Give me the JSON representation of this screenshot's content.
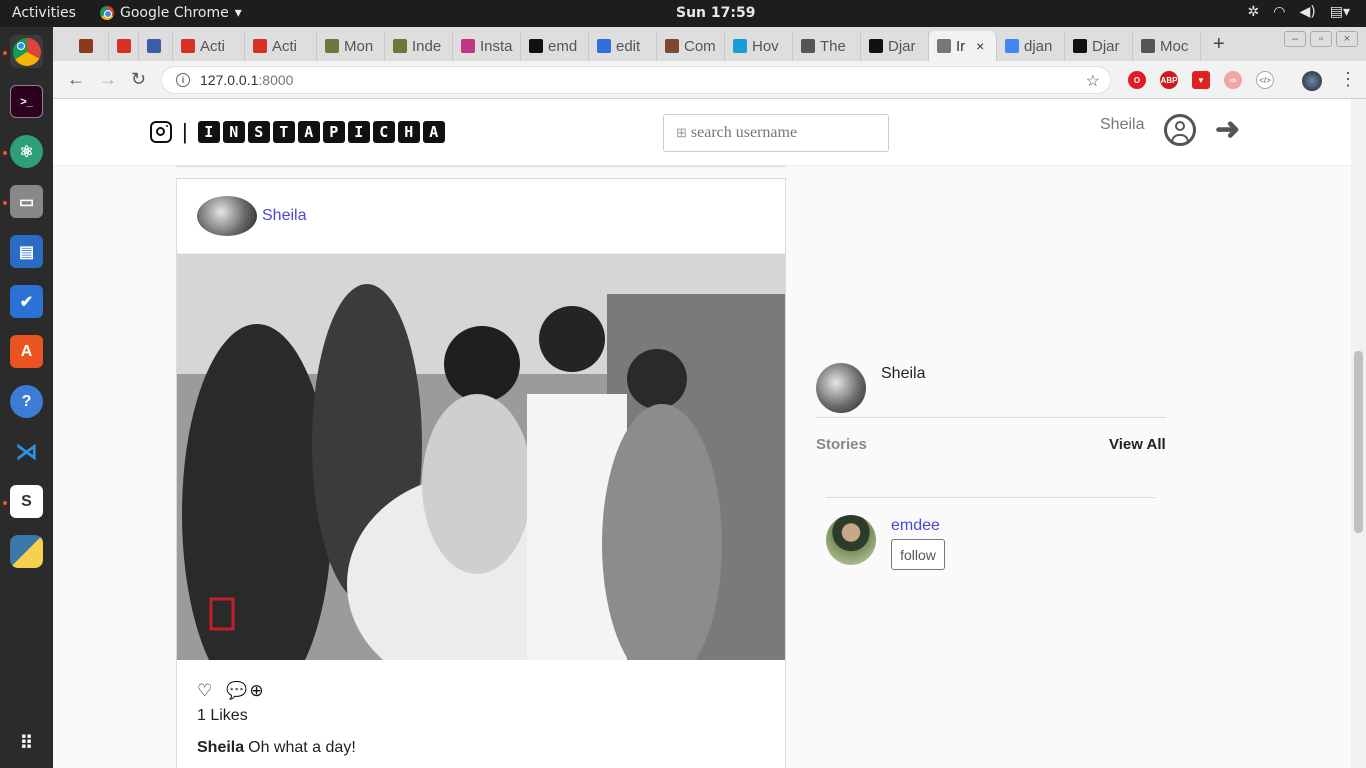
{
  "os": {
    "activities": "Activities",
    "app_name": "Google Chrome",
    "clock": "Sun 17:59"
  },
  "browser": {
    "tabs": [
      {
        "label": "",
        "icon": "book-icon",
        "color": "#8b3a1a"
      },
      {
        "label": "",
        "icon": "gmail-icon",
        "color": "#d93025"
      },
      {
        "label": "",
        "icon": "lifebuoy-icon",
        "color": "#3a5ea8"
      },
      {
        "label": "Acti",
        "icon": "gmail-icon",
        "color": "#d93025"
      },
      {
        "label": "Acti",
        "icon": "gmail-icon",
        "color": "#d93025"
      },
      {
        "label": "Mon",
        "icon": "tree-icon",
        "color": "#6b7a3a"
      },
      {
        "label": "Inde",
        "icon": "tree-icon",
        "color": "#6b7a3a"
      },
      {
        "label": "Insta",
        "icon": "instagram-icon",
        "color": "#c13584"
      },
      {
        "label": "emd",
        "icon": "github-icon",
        "color": "#111111"
      },
      {
        "label": "edit",
        "icon": "flag-icon",
        "color": "#2f6fe0"
      },
      {
        "label": "Com",
        "icon": "photo-icon",
        "color": "#7a4a2a"
      },
      {
        "label": "Hov",
        "icon": "s-icon",
        "color": "#1b9bd8"
      },
      {
        "label": "The",
        "icon": "doc-icon",
        "color": "#555555"
      },
      {
        "label": "Djar",
        "icon": "medium-icon",
        "color": "#111111"
      },
      {
        "label": "Ir",
        "icon": "page-icon",
        "color": "#777777"
      },
      {
        "label": "djan",
        "icon": "google-icon",
        "color": "#4285f4"
      },
      {
        "label": "Djar",
        "icon": "medium-icon",
        "color": "#111111"
      },
      {
        "label": "Moc",
        "icon": "puzzle-icon",
        "color": "#555555"
      }
    ],
    "url_host": "127.0.0.1",
    "url_port": ":8000"
  },
  "site": {
    "brand_letters": [
      "I",
      "N",
      "S",
      "T",
      "A",
      "P",
      "I",
      "C",
      "H",
      "A"
    ],
    "search_placeholder": "search username",
    "nav_username": "Sheila"
  },
  "post": {
    "username": "Sheila",
    "likes": "1 Likes",
    "caption_user": "Sheila",
    "caption_text": "Oh what a day!"
  },
  "sidebar": {
    "username": "Sheila",
    "stories_label": "Stories",
    "view_all": "View All",
    "suggestion": {
      "username": "emdee",
      "follow_label": "follow"
    }
  },
  "colors": {
    "link": "#4a4ad6",
    "page_bg": "#fafafa"
  }
}
